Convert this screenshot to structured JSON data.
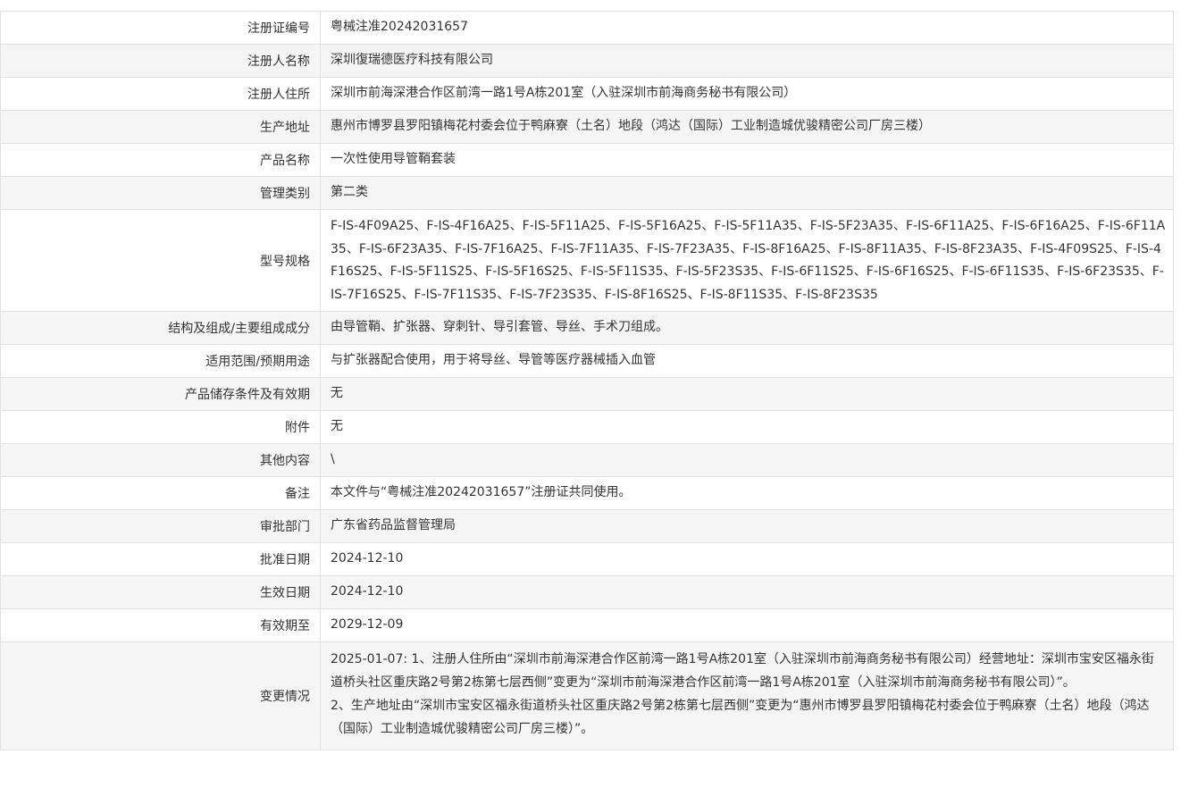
{
  "rows": [
    {
      "label": "注册证编号",
      "value": "粤械注准20242031657"
    },
    {
      "label": "注册人名称",
      "value": "深圳復瑞德医疗科技有限公司"
    },
    {
      "label": "注册人住所",
      "value": "深圳市前海深港合作区前湾一路1号A栋201室（入驻深圳市前海商务秘书有限公司）"
    },
    {
      "label": "生产地址",
      "value": "惠州市博罗县罗阳镇梅花村委会位于鸭麻寮（土名）地段（鸿达（国际）工业制造城优骏精密公司厂房三楼）"
    },
    {
      "label": "产品名称",
      "value": "一次性使用导管鞘套装"
    },
    {
      "label": "管理类别",
      "value": "第二类"
    },
    {
      "label": "型号规格",
      "value": "F-IS-4F09A25、F-IS-4F16A25、F-IS-5F11A25、F-IS-5F16A25、F-IS-5F11A35、F-IS-5F23A35、F-IS-6F11A25、F-IS-6F16A25、F-IS-6F11A35、F-IS-6F23A35、F-IS-7F16A25、F-IS-7F11A35、F-IS-7F23A35、F-IS-8F16A25、F-IS-8F11A35、F-IS-8F23A35、F-IS-4F09S25、F-IS-4F16S25、F-IS-5F11S25、F-IS-5F16S25、F-IS-5F11S35、F-IS-5F23S35、F-IS-6F11S25、F-IS-6F16S25、F-IS-6F11S35、F-IS-6F23S35、F-IS-7F16S25、F-IS-7F11S35、F-IS-7F23S35、F-IS-8F16S25、F-IS-8F11S35、F-IS-8F23S35"
    },
    {
      "label": "结构及组成/主要组成成分",
      "value": "由导管鞘、扩张器、穿刺针、导引套管、导丝、手术刀组成。"
    },
    {
      "label": "适用范围/预期用途",
      "value": "与扩张器配合使用，用于将导丝、导管等医疗器械插入血管"
    },
    {
      "label": "产品储存条件及有效期",
      "value": "无"
    },
    {
      "label": "附件",
      "value": "无"
    },
    {
      "label": "其他内容",
      "value": "\\"
    },
    {
      "label": "备注",
      "value": "本文件与“粤械注准20242031657”注册证共同使用。"
    },
    {
      "label": "审批部门",
      "value": "广东省药品监督管理局"
    },
    {
      "label": "批准日期",
      "value": "2024-12-10"
    },
    {
      "label": "生效日期",
      "value": "2024-12-10"
    },
    {
      "label": "有效期至",
      "value": "2029-12-09"
    },
    {
      "label": "变更情况",
      "value": ""
    }
  ],
  "changes": {
    "line1": "2025-01-07: 1、注册人住所由“深圳市前海深港合作区前湾一路1号A栋201室（入驻深圳市前海商务秘书有限公司）经营地址：深圳市宝安区福永街道桥头社区重庆路2号第2栋第七层西侧”变更为“深圳市前海深港合作区前湾一路1号A栋201室（入驻深圳市前海商务秘书有限公司）”。",
    "line2": "2、生产地址由“深圳市宝安区福永街道桥头社区重庆路2号第2栋第七层西侧”变更为“惠州市博罗县罗阳镇梅花村委会位于鸭麻寮（土名）地段（鸿达（国际）工业制造城优骏精密公司厂房三楼）”。"
  }
}
